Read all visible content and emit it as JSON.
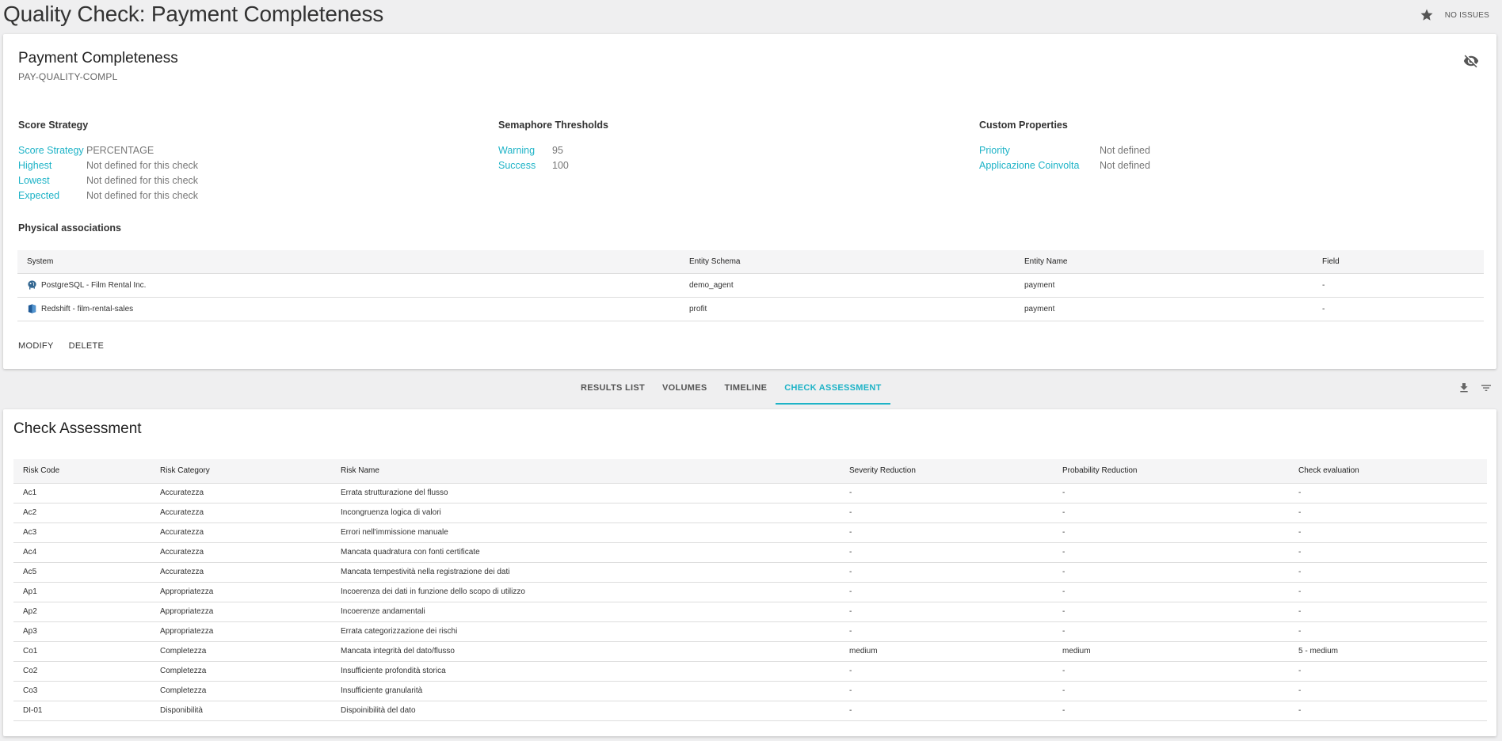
{
  "header": {
    "title": "Quality Check: Payment Completeness",
    "status_label": "NO ISSUES",
    "icons": {
      "favorite": "star-icon",
      "visibility": "eye-off-icon"
    }
  },
  "check": {
    "name": "Payment Completeness",
    "code": "PAY-QUALITY-COMPL"
  },
  "score_strategy": {
    "title": "Score Strategy",
    "rows": [
      {
        "label": "Score Strategy",
        "value": "PERCENTAGE"
      },
      {
        "label": "Highest",
        "value": "Not defined for this check"
      },
      {
        "label": "Lowest",
        "value": "Not defined for this check"
      },
      {
        "label": "Expected",
        "value": "Not defined for this check"
      }
    ]
  },
  "semaphore": {
    "title": "Semaphore Thresholds",
    "rows": [
      {
        "label": "Warning",
        "value": "95"
      },
      {
        "label": "Success",
        "value": "100"
      }
    ]
  },
  "custom_properties": {
    "title": "Custom Properties",
    "rows": [
      {
        "label": "Priority",
        "value": "Not defined"
      },
      {
        "label": "Applicazione Coinvolta",
        "value": "Not defined"
      }
    ]
  },
  "physical_associations": {
    "title": "Physical associations",
    "columns": [
      "System",
      "Entity Schema",
      "Entity Name",
      "Field"
    ],
    "rows": [
      {
        "system": "PostgreSQL - Film Rental Inc.",
        "system_icon": "postgresql-icon",
        "schema": "demo_agent",
        "entity": "payment",
        "field": "-"
      },
      {
        "system": "Redshift - film-rental-sales",
        "system_icon": "redshift-icon",
        "schema": "profit",
        "entity": "payment",
        "field": "-"
      }
    ]
  },
  "actions": {
    "modify": "MODIFY",
    "delete": "DELETE"
  },
  "tabs": [
    {
      "label": "RESULTS LIST",
      "active": false
    },
    {
      "label": "VOLUMES",
      "active": false
    },
    {
      "label": "TIMELINE",
      "active": false
    },
    {
      "label": "CHECK ASSESSMENT",
      "active": true
    }
  ],
  "toolbar": {
    "download_icon": "download-icon",
    "filter_icon": "filter-icon"
  },
  "check_assessment": {
    "title": "Check Assessment",
    "columns": [
      "Risk Code",
      "Risk Category",
      "Risk Name",
      "Severity Reduction",
      "Probability Reduction",
      "Check evaluation"
    ],
    "rows": [
      [
        "Ac1",
        "Accuratezza",
        "Errata strutturazione del flusso",
        "-",
        "-",
        "-"
      ],
      [
        "Ac2",
        "Accuratezza",
        "Incongruenza logica di valori",
        "-",
        "-",
        "-"
      ],
      [
        "Ac3",
        "Accuratezza",
        "Errori nell'immissione manuale",
        "-",
        "-",
        "-"
      ],
      [
        "Ac4",
        "Accuratezza",
        "Mancata quadratura con fonti certificate",
        "-",
        "-",
        "-"
      ],
      [
        "Ac5",
        "Accuratezza",
        "Mancata tempestività nella registrazione dei dati",
        "-",
        "-",
        "-"
      ],
      [
        "Ap1",
        "Appropriatezza",
        "Incoerenza dei dati in funzione dello scopo di utilizzo",
        "-",
        "-",
        "-"
      ],
      [
        "Ap2",
        "Appropriatezza",
        "Incoerenze andamentali",
        "-",
        "-",
        "-"
      ],
      [
        "Ap3",
        "Appropriatezza",
        "Errata categorizzazione dei rischi",
        "-",
        "-",
        "-"
      ],
      [
        "Co1",
        "Completezza",
        "Mancata integrità del dato/flusso",
        "medium",
        "medium",
        "5 - medium"
      ],
      [
        "Co2",
        "Completezza",
        "Insufficiente profondità storica",
        "-",
        "-",
        "-"
      ],
      [
        "Co3",
        "Completezza",
        "Insufficiente granularità",
        "-",
        "-",
        "-"
      ],
      [
        "DI-01",
        "Disponibilità",
        "Dispoinibilità del dato",
        "-",
        "-",
        "-"
      ]
    ]
  },
  "colors": {
    "accent": "#1eb3c7",
    "background": "#efeff0",
    "card": "#ffffff"
  }
}
